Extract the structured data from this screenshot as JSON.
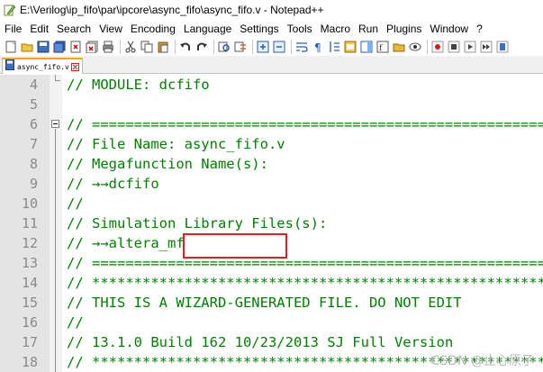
{
  "window": {
    "title": "E:\\Verilog\\ip_fifo\\par\\ipcore\\async_fifo\\async_fifo.v - Notepad++"
  },
  "menu": {
    "items": [
      "File",
      "Edit",
      "Search",
      "View",
      "Encoding",
      "Language",
      "Settings",
      "Tools",
      "Macro",
      "Run",
      "Plugins",
      "Window",
      "?"
    ]
  },
  "toolbar": {
    "icons": [
      "new-file-icon",
      "open-file-icon",
      "save-icon",
      "save-all-icon",
      "close-icon",
      "close-all-icon",
      "print-icon",
      "cut-icon",
      "copy-icon",
      "paste-icon",
      "undo-icon",
      "redo-icon",
      "find-icon",
      "replace-icon",
      "zoom-in-icon",
      "zoom-out-icon",
      "sync-v-icon",
      "sync-h-icon",
      "word-wrap-icon",
      "show-all-chars-icon",
      "indent-guide-icon",
      "lang-icon",
      "doc-map-icon",
      "function-list-icon",
      "folder-workspace-icon",
      "monitor-icon",
      "record-macro-icon",
      "stop-macro-icon",
      "play-macro-icon",
      "play-multiple-icon",
      "save-macro-icon"
    ]
  },
  "tab": {
    "label": "async_fifo.v"
  },
  "editor": {
    "lines": [
      {
        "num": "4",
        "text": "// MODULE: dcfifo"
      },
      {
        "num": "5",
        "text": ""
      },
      {
        "num": "6",
        "text": "// ============================================================"
      },
      {
        "num": "7",
        "text": "// File Name: async_fifo.v"
      },
      {
        "num": "8",
        "text": "// Megafunction Name(s):"
      },
      {
        "num": "9",
        "text": "// →→dcfifo"
      },
      {
        "num": "10",
        "text": "//"
      },
      {
        "num": "11",
        "text": "// Simulation Library Files(s):"
      },
      {
        "num": "12",
        "text": "// →→altera_mf"
      },
      {
        "num": "13",
        "text": "// ============================================================"
      },
      {
        "num": "14",
        "text": "// ************************************************************"
      },
      {
        "num": "15",
        "text": "// THIS IS A WIZARD-GENERATED FILE. DO NOT EDIT"
      },
      {
        "num": "16",
        "text": "//"
      },
      {
        "num": "17",
        "text": "// 13.1.0 Build 162 10/23/2013 SJ Full Version"
      },
      {
        "num": "18",
        "text": "// ************************************************************"
      }
    ]
  },
  "watermark": "CSDN @止心原子"
}
